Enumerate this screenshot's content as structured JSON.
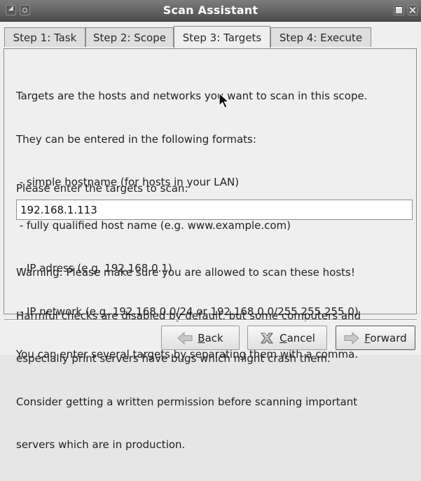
{
  "window": {
    "title": "Scan Assistant"
  },
  "tabs": [
    {
      "label": "Step 1: Task",
      "active": false
    },
    {
      "label": "Step 2: Scope",
      "active": false
    },
    {
      "label": "Step 3: Targets",
      "active": true
    },
    {
      "label": "Step 4: Execute",
      "active": false
    }
  ],
  "content": {
    "intro_lines": [
      "Targets are the hosts and networks you want to scan in this scope.",
      "They can be entered in the following formats:",
      " - simple hostname (for hosts in your LAN)",
      " - fully qualified host name (e.g. www.example.com)",
      " - IP adress (e.g. 192.168.0.1)",
      " - IP network (e.g. 192.168.0.0/24 or 192.168.0.0/255.255.255.0)",
      "You can enter several targets by separating them with a comma."
    ],
    "targets_label": "Please enter the targets to scan:",
    "targets_value": "192.168.1.113",
    "warning_lines": [
      "Warning: Please make sure you are allowed to scan these hosts!",
      "Harmful checks are disabled by default, but some computers and",
      "especially print servers have bugs which might crash them.",
      "Consider getting a written permission before scanning important",
      "servers which are in production."
    ]
  },
  "buttons": {
    "back": {
      "mnemonic": "B",
      "rest": "ack",
      "icon": "arrow-left-icon"
    },
    "cancel": {
      "mnemonic": "C",
      "rest": "ancel",
      "icon": "cancel-x-icon"
    },
    "forward": {
      "mnemonic": "F",
      "rest": "orward",
      "icon": "arrow-right-icon"
    }
  },
  "colors": {
    "titlebar": "#5c5c5c",
    "window_bg": "#efefef",
    "arrow_fill": "#c8c8c8"
  }
}
